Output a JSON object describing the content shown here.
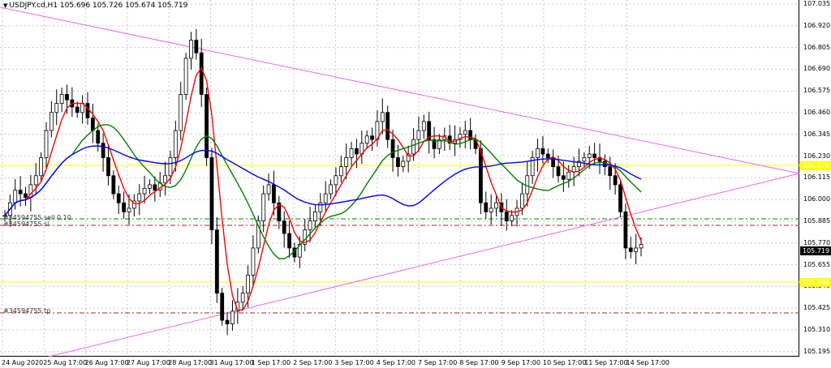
{
  "header": {
    "symbol_line": "USDJPY.cd,H1  105.696 105.726 105.674 105.719"
  },
  "price_axis": {
    "labels": [
      "107.035",
      "106.920",
      "106.805",
      "106.690",
      "106.575",
      "106.460",
      "106.345",
      "106.230",
      "106.115",
      "106.000",
      "105.885",
      "105.770",
      "105.655",
      "105.540",
      "105.425",
      "105.310",
      "105.195"
    ],
    "current_price": "105.719",
    "upper_hline_price": "106.175",
    "lower_hline_price": "105.590"
  },
  "time_axis": {
    "labels": [
      "24 Aug 2020",
      "25 Aug 17:00",
      "26 Aug 17:00",
      "27 Aug 17:00",
      "28 Aug 17:00",
      "31 Aug 17:00",
      "1 Sep 17:00",
      "2 Sep 17:00",
      "3 Sep 17:00",
      "4 Sep 17:00",
      "7 Sep 17:00",
      "8 Sep 17:00",
      "9 Sep 17:00",
      "10 Sep 17:00",
      "11 Sep 17:00",
      "14 Sep 17:00"
    ]
  },
  "orders": {
    "sl_label": "#34594755 sell 0.10",
    "sl_sub": "#34594755 sl",
    "tp_label": "#34594755 tp"
  },
  "colors": {
    "background": "#ffffff",
    "grid": "#c8c8c8",
    "triangle": "#ee66ee",
    "hline": "#ffff00",
    "ma_fast": "#ff0000",
    "ma_mid": "#008000",
    "ma_slow": "#0000ff",
    "order_green": "#008000",
    "order_red": "#b22222",
    "candle": "#000000"
  },
  "chart_data": {
    "type": "candlestick",
    "y_range": [
      105.13,
      107.05
    ],
    "closes": [
      105.88,
      105.95,
      106.02,
      106.0,
      105.98,
      106.05,
      106.1,
      106.2,
      106.35,
      106.45,
      106.5,
      106.55,
      106.52,
      106.48,
      106.45,
      106.5,
      106.42,
      106.35,
      106.28,
      106.2,
      106.1,
      106.0,
      105.95,
      105.9,
      105.92,
      105.96,
      106.0,
      106.03,
      106.05,
      106.02,
      106.06,
      106.1,
      106.2,
      106.35,
      106.55,
      106.75,
      106.85,
      106.78,
      106.55,
      106.2,
      105.8,
      105.45,
      105.3,
      105.28,
      105.35,
      105.4,
      105.45,
      105.55,
      105.7,
      105.85,
      106.0,
      106.05,
      105.95,
      105.85,
      105.78,
      105.7,
      105.65,
      105.72,
      105.8,
      105.85,
      105.9,
      105.95,
      106.0,
      106.05,
      106.1,
      106.15,
      106.2,
      106.25,
      106.22,
      106.28,
      106.32,
      106.3,
      106.4,
      106.45,
      106.3,
      106.2,
      106.15,
      106.18,
      106.22,
      106.3,
      106.35,
      106.4,
      106.3,
      106.25,
      106.3,
      106.32,
      106.28,
      106.3,
      106.33,
      106.35,
      106.3,
      106.25,
      105.95,
      105.9,
      105.92,
      105.95,
      105.9,
      105.85,
      105.88,
      105.92,
      106.0,
      106.1,
      106.2,
      106.25,
      106.22,
      106.2,
      106.15,
      106.1,
      106.08,
      106.12,
      106.15,
      106.18,
      106.2,
      106.22,
      106.2,
      106.18,
      106.15,
      106.1,
      106.05,
      105.9,
      105.7,
      105.68,
      105.7,
      105.72
    ]
  }
}
